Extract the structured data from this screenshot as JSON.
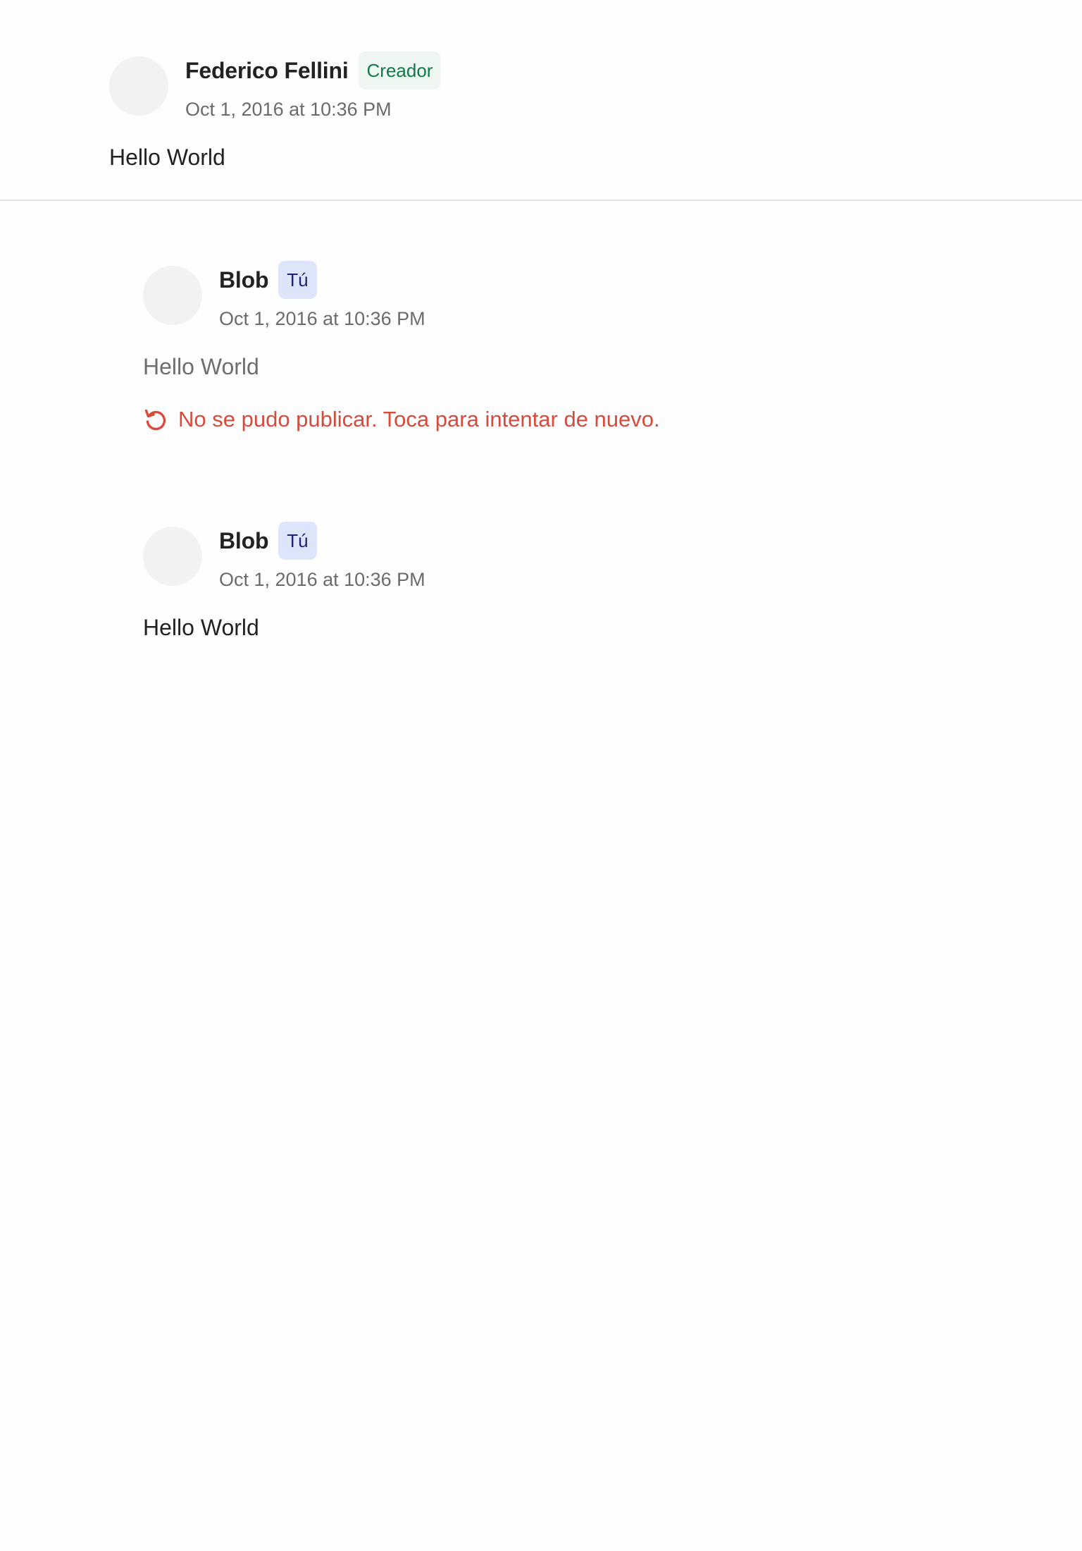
{
  "colors": {
    "creator_badge_bg": "#eef7f2",
    "creator_badge_text": "#0f7a4a",
    "you_badge_bg": "#dde5fb",
    "you_badge_text": "#1a237e",
    "error": "#d64b3c",
    "avatar_placeholder": "#f2f2f2"
  },
  "main_comment": {
    "author": "Federico Fellini",
    "badge": "Creador",
    "timestamp": "Oct 1, 2016 at 10:36 PM",
    "body": "Hello World"
  },
  "replies": [
    {
      "author": "Blob",
      "badge": "Tú",
      "timestamp": "Oct 1, 2016 at 10:36 PM",
      "body": "Hello World",
      "status": "failed",
      "error_icon": "retry-icon",
      "error_message": "No se pudo publicar. Toca para intentar de nuevo."
    },
    {
      "author": "Blob",
      "badge": "Tú",
      "timestamp": "Oct 1, 2016 at 10:36 PM",
      "body": "Hello World"
    }
  ]
}
